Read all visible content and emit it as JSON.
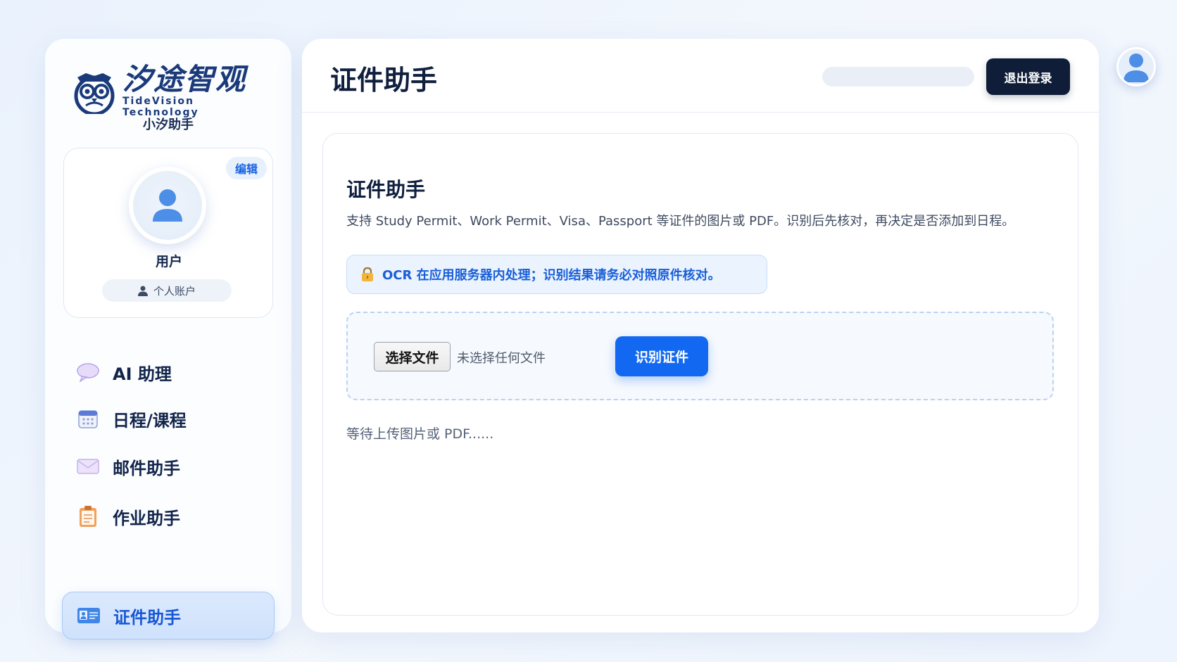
{
  "brand": {
    "name_cn": "汐途智观",
    "name_en": "TideVision Technology",
    "app_name": "小汐助手"
  },
  "profile": {
    "edit_label": "编辑",
    "user_name": "用户",
    "account_type": "个人账户"
  },
  "nav": {
    "items": [
      {
        "label": "AI 助理",
        "icon": "speech-bubble-icon"
      },
      {
        "label": "日程/课程",
        "icon": "calendar-icon"
      },
      {
        "label": "邮件助手",
        "icon": "envelope-icon"
      },
      {
        "label": "作业助手",
        "icon": "clipboard-icon"
      },
      {
        "label": "证件助手",
        "icon": "id-card-icon",
        "active": true
      }
    ]
  },
  "header": {
    "title": "证件助手",
    "logout_label": "退出登录"
  },
  "card": {
    "title": "证件助手",
    "description": "支持 Study Permit、Work Permit、Visa、Passport 等证件的图片或 PDF。识别后先核对，再决定是否添加到日程。",
    "notice": "OCR 在应用服务器内处理；识别结果请务必对照原件核对。",
    "file_button": "选择文件",
    "file_status": "未选择任何文件",
    "recognize_button": "识别证件",
    "status_text": "等待上传图片或 PDF......"
  },
  "colors": {
    "accent": "#1268f0",
    "dark_button": "#0f1d38",
    "brand_navy": "#1a3a7a"
  }
}
